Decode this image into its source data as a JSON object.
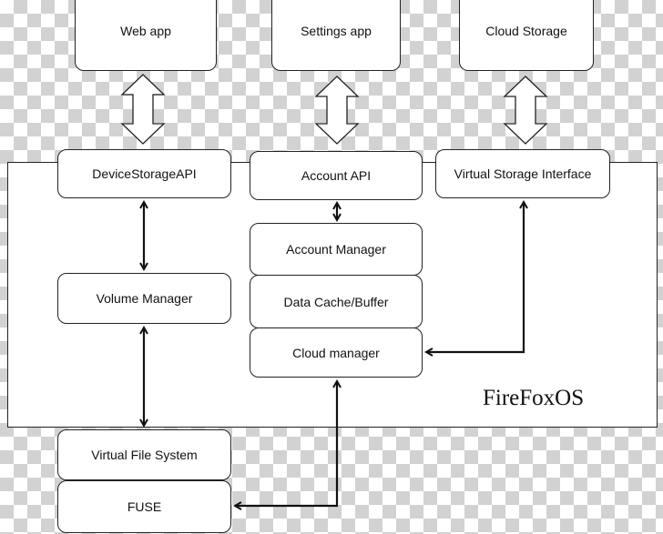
{
  "top_apps": {
    "web_app": "Web app",
    "settings_app": "Settings app",
    "cloud_storage": "Cloud Storage"
  },
  "apis": {
    "device_storage": "DeviceStorageAPI",
    "account": "Account API",
    "virtual_storage": "Virtual Storage Interface"
  },
  "modules": {
    "volume_manager": "Volume Manager",
    "account_manager": "Account Manager",
    "data_cache": "Data Cache/Buffer",
    "cloud_manager": "Cloud manager"
  },
  "bottom": {
    "vfs": "Virtual File System",
    "fuse": "FUSE"
  },
  "container_label": "FireFoxOS"
}
